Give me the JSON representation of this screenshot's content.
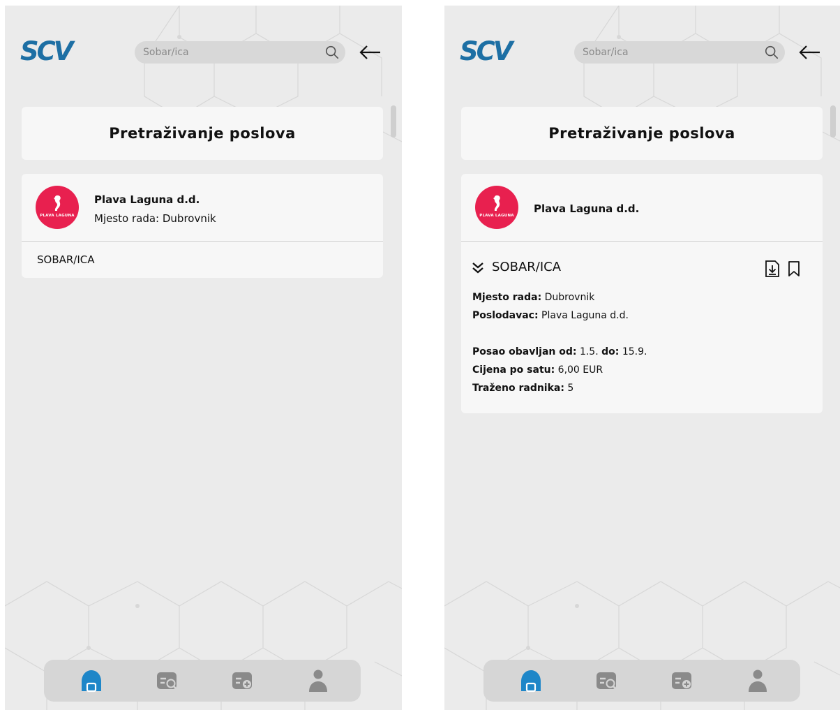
{
  "screens": [
    {
      "logo": "SCV",
      "search": {
        "value": "Sobar/ica"
      },
      "page_title": "Pretraživanje poslova",
      "job": {
        "company_logo_text": "PLAVA LAGUNA",
        "company_name": "Plava Laguna d.d.",
        "place": "Mjesto rada: Dubrovnik",
        "title": "SOBAR/ICA"
      }
    },
    {
      "logo": "SCV",
      "search": {
        "value": "Sobar/ica"
      },
      "page_title": "Pretraživanje poslova",
      "job": {
        "company_logo_text": "PLAVA LAGUNA",
        "company_name": "Plava Laguna d.d.",
        "title": "SOBAR/ICA",
        "details": [
          {
            "label": "Mjesto rada:",
            "value": "Dubrovnik"
          },
          {
            "label": "Poslodavac:",
            "value": "Plava Laguna d.d."
          },
          {
            "label": "Posao obavljan od:",
            "value": "1.5.",
            "label2": "do:",
            "value2": "15.9."
          },
          {
            "label": "Cijena po satu:",
            "value": "6,00 EUR"
          },
          {
            "label": "Traženo radnika:",
            "value": "5"
          }
        ]
      }
    }
  ],
  "bottom_nav": [
    "home-icon",
    "job-search-icon",
    "job-add-icon",
    "profile-icon"
  ],
  "colors": {
    "brand_blue": "#1d6fa4",
    "brand_dark": "#144a78",
    "nav_active": "#1e86c8",
    "nav_inactive": "#8a8a8a",
    "company_logo_red": "#e8204f",
    "background": "#ebebeb",
    "card": "#f7f7f7"
  }
}
